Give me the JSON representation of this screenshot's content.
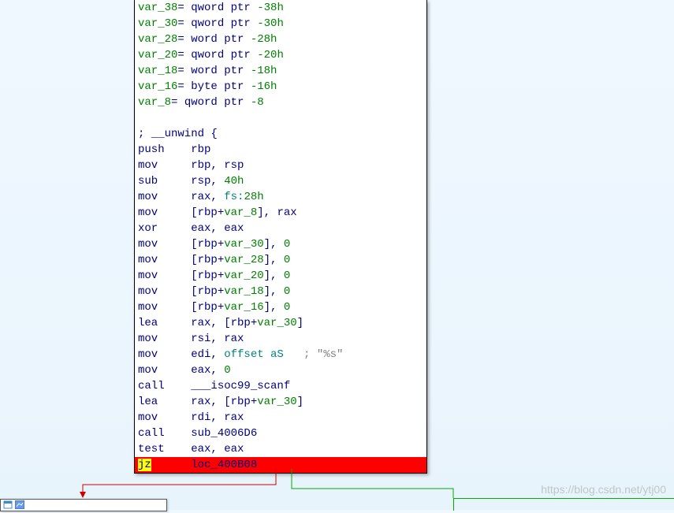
{
  "lines": [
    {
      "segs": [
        {
          "t": "var_38",
          "c": "c-green"
        },
        {
          "t": "= qword ptr ",
          "c": "c-navy"
        },
        {
          "t": "-38h",
          "c": "c-green"
        }
      ]
    },
    {
      "segs": [
        {
          "t": "var_30",
          "c": "c-green"
        },
        {
          "t": "= qword ptr ",
          "c": "c-navy"
        },
        {
          "t": "-30h",
          "c": "c-green"
        }
      ]
    },
    {
      "segs": [
        {
          "t": "var_28",
          "c": "c-green"
        },
        {
          "t": "= word ptr ",
          "c": "c-navy"
        },
        {
          "t": "-28h",
          "c": "c-green"
        }
      ]
    },
    {
      "segs": [
        {
          "t": "var_20",
          "c": "c-green"
        },
        {
          "t": "= qword ptr ",
          "c": "c-navy"
        },
        {
          "t": "-20h",
          "c": "c-green"
        }
      ]
    },
    {
      "segs": [
        {
          "t": "var_18",
          "c": "c-green"
        },
        {
          "t": "= word ptr ",
          "c": "c-navy"
        },
        {
          "t": "-18h",
          "c": "c-green"
        }
      ]
    },
    {
      "segs": [
        {
          "t": "var_16",
          "c": "c-green"
        },
        {
          "t": "= byte ptr ",
          "c": "c-navy"
        },
        {
          "t": "-16h",
          "c": "c-green"
        }
      ]
    },
    {
      "segs": [
        {
          "t": "var_8",
          "c": "c-green"
        },
        {
          "t": "= qword ptr ",
          "c": "c-navy"
        },
        {
          "t": "-8",
          "c": "c-green"
        }
      ]
    },
    {
      "segs": [
        {
          "t": "",
          "c": ""
        }
      ]
    },
    {
      "segs": [
        {
          "t": "; __unwind {",
          "c": "c-navy"
        }
      ]
    },
    {
      "segs": [
        {
          "t": "push    rbp",
          "c": "c-navy"
        }
      ]
    },
    {
      "segs": [
        {
          "t": "mov     rbp, rsp",
          "c": "c-navy"
        }
      ]
    },
    {
      "segs": [
        {
          "t": "sub     rsp, ",
          "c": "c-navy"
        },
        {
          "t": "40h",
          "c": "c-green"
        }
      ]
    },
    {
      "segs": [
        {
          "t": "mov     rax, ",
          "c": "c-navy"
        },
        {
          "t": "fs:",
          "c": "c-teal"
        },
        {
          "t": "28h",
          "c": "c-green"
        }
      ]
    },
    {
      "segs": [
        {
          "t": "mov     [rbp+",
          "c": "c-navy"
        },
        {
          "t": "var_8",
          "c": "c-green"
        },
        {
          "t": "], rax",
          "c": "c-navy"
        }
      ]
    },
    {
      "segs": [
        {
          "t": "xor     eax, eax",
          "c": "c-navy"
        }
      ]
    },
    {
      "segs": [
        {
          "t": "mov     [rbp+",
          "c": "c-navy"
        },
        {
          "t": "var_30",
          "c": "c-green"
        },
        {
          "t": "], ",
          "c": "c-navy"
        },
        {
          "t": "0",
          "c": "c-green"
        }
      ]
    },
    {
      "segs": [
        {
          "t": "mov     [rbp+",
          "c": "c-navy"
        },
        {
          "t": "var_28",
          "c": "c-green"
        },
        {
          "t": "], ",
          "c": "c-navy"
        },
        {
          "t": "0",
          "c": "c-green"
        }
      ]
    },
    {
      "segs": [
        {
          "t": "mov     [rbp+",
          "c": "c-navy"
        },
        {
          "t": "var_20",
          "c": "c-green"
        },
        {
          "t": "], ",
          "c": "c-navy"
        },
        {
          "t": "0",
          "c": "c-green"
        }
      ]
    },
    {
      "segs": [
        {
          "t": "mov     [rbp+",
          "c": "c-navy"
        },
        {
          "t": "var_18",
          "c": "c-green"
        },
        {
          "t": "], ",
          "c": "c-navy"
        },
        {
          "t": "0",
          "c": "c-green"
        }
      ]
    },
    {
      "segs": [
        {
          "t": "mov     [rbp+",
          "c": "c-navy"
        },
        {
          "t": "var_16",
          "c": "c-green"
        },
        {
          "t": "], ",
          "c": "c-navy"
        },
        {
          "t": "0",
          "c": "c-green"
        }
      ]
    },
    {
      "segs": [
        {
          "t": "lea     rax, [rbp+",
          "c": "c-navy"
        },
        {
          "t": "var_30",
          "c": "c-green"
        },
        {
          "t": "]",
          "c": "c-navy"
        }
      ]
    },
    {
      "segs": [
        {
          "t": "mov     rsi, rax",
          "c": "c-navy"
        }
      ]
    },
    {
      "segs": [
        {
          "t": "mov     edi, ",
          "c": "c-navy"
        },
        {
          "t": "offset aS",
          "c": "c-teal"
        },
        {
          "t": "   ; \"%s\"",
          "c": "c-gray"
        }
      ]
    },
    {
      "segs": [
        {
          "t": "mov     eax, ",
          "c": "c-navy"
        },
        {
          "t": "0",
          "c": "c-green"
        }
      ]
    },
    {
      "segs": [
        {
          "t": "call    ",
          "c": "c-navy"
        },
        {
          "t": "___isoc99_scanf",
          "c": "c-navy"
        }
      ]
    },
    {
      "segs": [
        {
          "t": "lea     rax, [rbp+",
          "c": "c-navy"
        },
        {
          "t": "var_30",
          "c": "c-green"
        },
        {
          "t": "]",
          "c": "c-navy"
        }
      ]
    },
    {
      "segs": [
        {
          "t": "mov     rdi, rax",
          "c": "c-navy"
        }
      ]
    },
    {
      "segs": [
        {
          "t": "call    ",
          "c": "c-navy"
        },
        {
          "t": "sub_4006D6",
          "c": "c-navy"
        }
      ]
    },
    {
      "segs": [
        {
          "t": "test    eax, eax",
          "c": "c-navy"
        }
      ]
    }
  ],
  "highlight": {
    "jz": "jz",
    "loc": "      loc_400B08"
  },
  "watermark": "https://blog.csdn.net/ytj00"
}
